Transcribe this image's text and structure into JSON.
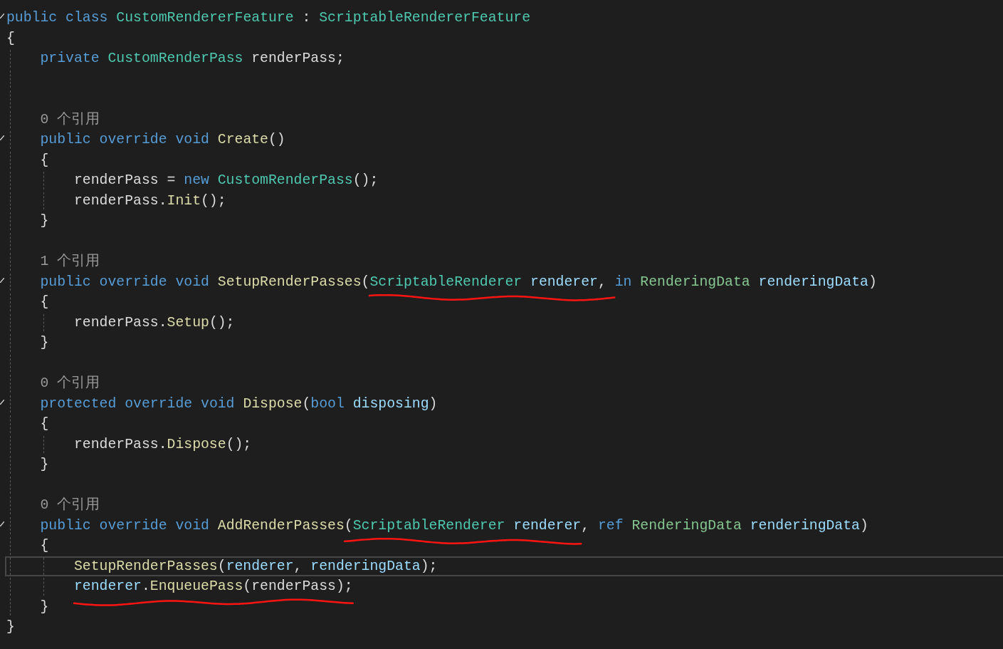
{
  "editor": {
    "lines": [
      {
        "kind": "code",
        "collapsible": true,
        "current": false,
        "tokens": [
          {
            "text": "public class ",
            "kind": "keyword",
            "underlined": false
          },
          {
            "text": "CustomRendererFeature",
            "kind": "type",
            "underlined": false
          },
          {
            "text": " : ",
            "kind": "plain",
            "underlined": false
          },
          {
            "text": "ScriptableRendererFeature",
            "kind": "type",
            "underlined": false
          }
        ]
      },
      {
        "kind": "code",
        "collapsible": false,
        "current": false,
        "tokens": [
          {
            "text": "{",
            "kind": "plain",
            "underlined": false
          }
        ],
        "children": [
          {
            "kind": "code",
            "collapsible": false,
            "current": false,
            "tokens": [
              {
                "text": "private ",
                "kind": "keyword",
                "underlined": false
              },
              {
                "text": "CustomRenderPass",
                "kind": "type",
                "underlined": false
              },
              {
                "text": " renderPass;",
                "kind": "plain",
                "underlined": false
              }
            ]
          },
          {
            "kind": "blank"
          },
          {
            "kind": "blank"
          },
          {
            "kind": "codelens",
            "text": "0 个引用"
          },
          {
            "kind": "code",
            "collapsible": true,
            "current": false,
            "tokens": [
              {
                "text": "public override void ",
                "kind": "keyword",
                "underlined": false
              },
              {
                "text": "Create",
                "kind": "method",
                "underlined": false
              },
              {
                "text": "()",
                "kind": "plain",
                "underlined": false
              }
            ]
          },
          {
            "kind": "code",
            "collapsible": false,
            "current": false,
            "tokens": [
              {
                "text": "{",
                "kind": "plain",
                "underlined": false
              }
            ],
            "children": [
              {
                "kind": "code",
                "collapsible": false,
                "current": false,
                "tokens": [
                  {
                    "text": "renderPass = ",
                    "kind": "plain",
                    "underlined": false
                  },
                  {
                    "text": "new ",
                    "kind": "keyword",
                    "underlined": false
                  },
                  {
                    "text": "CustomRenderPass",
                    "kind": "type",
                    "underlined": false
                  },
                  {
                    "text": "();",
                    "kind": "plain",
                    "underlined": false
                  }
                ]
              },
              {
                "kind": "code",
                "collapsible": false,
                "current": false,
                "tokens": [
                  {
                    "text": "renderPass.",
                    "kind": "plain",
                    "underlined": false
                  },
                  {
                    "text": "Init",
                    "kind": "method",
                    "underlined": false
                  },
                  {
                    "text": "();",
                    "kind": "plain",
                    "underlined": false
                  }
                ]
              }
            ]
          },
          {
            "kind": "code",
            "collapsible": false,
            "current": false,
            "tokens": [
              {
                "text": "}",
                "kind": "plain",
                "underlined": false
              }
            ]
          },
          {
            "kind": "blank"
          },
          {
            "kind": "codelens",
            "text": "1 个引用"
          },
          {
            "kind": "code",
            "collapsible": true,
            "current": false,
            "tokens": [
              {
                "text": "public override void ",
                "kind": "keyword",
                "underlined": false
              },
              {
                "text": "SetupRenderPasses",
                "kind": "method",
                "underlined": false
              },
              {
                "text": "(",
                "kind": "plain",
                "underlined": false
              },
              {
                "text": "ScriptableRenderer",
                "kind": "type",
                "underlined": true
              },
              {
                "text": " renderer",
                "kind": "param",
                "underlined": true
              },
              {
                "text": ", ",
                "kind": "plain",
                "underlined": true
              },
              {
                "text": "in ",
                "kind": "keyword",
                "underlined": false
              },
              {
                "text": "RenderingData",
                "kind": "struct",
                "underlined": false
              },
              {
                "text": " renderingData",
                "kind": "param",
                "underlined": false
              },
              {
                "text": ")",
                "kind": "plain",
                "underlined": false
              }
            ]
          },
          {
            "kind": "code",
            "collapsible": false,
            "current": false,
            "tokens": [
              {
                "text": "{",
                "kind": "plain",
                "underlined": false
              }
            ],
            "children": [
              {
                "kind": "code",
                "collapsible": false,
                "current": false,
                "tokens": [
                  {
                    "text": "renderPass.",
                    "kind": "plain",
                    "underlined": false
                  },
                  {
                    "text": "Setup",
                    "kind": "method",
                    "underlined": false
                  },
                  {
                    "text": "();",
                    "kind": "plain",
                    "underlined": false
                  }
                ]
              }
            ]
          },
          {
            "kind": "code",
            "collapsible": false,
            "current": false,
            "tokens": [
              {
                "text": "}",
                "kind": "plain",
                "underlined": false
              }
            ]
          },
          {
            "kind": "blank"
          },
          {
            "kind": "codelens",
            "text": "0 个引用"
          },
          {
            "kind": "code",
            "collapsible": true,
            "current": false,
            "tokens": [
              {
                "text": "protected override void ",
                "kind": "keyword",
                "underlined": false
              },
              {
                "text": "Dispose",
                "kind": "method",
                "underlined": false
              },
              {
                "text": "(",
                "kind": "plain",
                "underlined": false
              },
              {
                "text": "bool ",
                "kind": "keyword",
                "underlined": false
              },
              {
                "text": "disposing",
                "kind": "param",
                "underlined": false
              },
              {
                "text": ")",
                "kind": "plain",
                "underlined": false
              }
            ]
          },
          {
            "kind": "code",
            "collapsible": false,
            "current": false,
            "tokens": [
              {
                "text": "{",
                "kind": "plain",
                "underlined": false
              }
            ],
            "children": [
              {
                "kind": "code",
                "collapsible": false,
                "current": false,
                "tokens": [
                  {
                    "text": "renderPass.",
                    "kind": "plain",
                    "underlined": false
                  },
                  {
                    "text": "Dispose",
                    "kind": "method",
                    "underlined": false
                  },
                  {
                    "text": "();",
                    "kind": "plain",
                    "underlined": false
                  }
                ]
              }
            ]
          },
          {
            "kind": "code",
            "collapsible": false,
            "current": false,
            "tokens": [
              {
                "text": "}",
                "kind": "plain",
                "underlined": false
              }
            ]
          },
          {
            "kind": "blank"
          },
          {
            "kind": "codelens",
            "text": "0 个引用"
          },
          {
            "kind": "code",
            "collapsible": true,
            "current": false,
            "tokens": [
              {
                "text": "public override void ",
                "kind": "keyword",
                "underlined": false
              },
              {
                "text": "AddRenderPasses",
                "kind": "method",
                "underlined": false
              },
              {
                "text": "(",
                "kind": "plain",
                "underlined": true
              },
              {
                "text": "ScriptableRenderer",
                "kind": "type",
                "underlined": true
              },
              {
                "text": " renderer",
                "kind": "param",
                "underlined": true
              },
              {
                "text": ", ",
                "kind": "plain",
                "underlined": false
              },
              {
                "text": "ref ",
                "kind": "keyword",
                "underlined": false
              },
              {
                "text": "RenderingData",
                "kind": "struct",
                "underlined": false
              },
              {
                "text": " renderingData",
                "kind": "param",
                "underlined": false
              },
              {
                "text": ")",
                "kind": "plain",
                "underlined": false
              }
            ]
          },
          {
            "kind": "code",
            "collapsible": false,
            "current": false,
            "tokens": [
              {
                "text": "{",
                "kind": "plain",
                "underlined": false
              }
            ],
            "children": [
              {
                "kind": "code",
                "collapsible": false,
                "current": true,
                "tokens": [
                  {
                    "text": "SetupRenderPasses",
                    "kind": "method",
                    "underlined": false
                  },
                  {
                    "text": "(",
                    "kind": "plain",
                    "underlined": false
                  },
                  {
                    "text": "renderer",
                    "kind": "param",
                    "underlined": false
                  },
                  {
                    "text": ", ",
                    "kind": "plain",
                    "underlined": false
                  },
                  {
                    "text": "renderingData",
                    "kind": "param",
                    "underlined": false
                  },
                  {
                    "text": ");",
                    "kind": "plain",
                    "underlined": false
                  }
                ]
              },
              {
                "kind": "code",
                "collapsible": false,
                "current": false,
                "tokens": [
                  {
                    "text": "renderer",
                    "kind": "param",
                    "underlined": true
                  },
                  {
                    "text": ".",
                    "kind": "plain",
                    "underlined": true
                  },
                  {
                    "text": "EnqueuePass",
                    "kind": "method",
                    "underlined": true
                  },
                  {
                    "text": "(renderPass);",
                    "kind": "plain",
                    "underlined": true
                  }
                ]
              }
            ]
          },
          {
            "kind": "code",
            "collapsible": false,
            "current": false,
            "tokens": [
              {
                "text": "}",
                "kind": "plain",
                "underlined": false
              }
            ]
          }
        ]
      },
      {
        "kind": "code",
        "collapsible": false,
        "current": false,
        "tokens": [
          {
            "text": "}",
            "kind": "plain",
            "underlined": false
          }
        ]
      }
    ]
  }
}
